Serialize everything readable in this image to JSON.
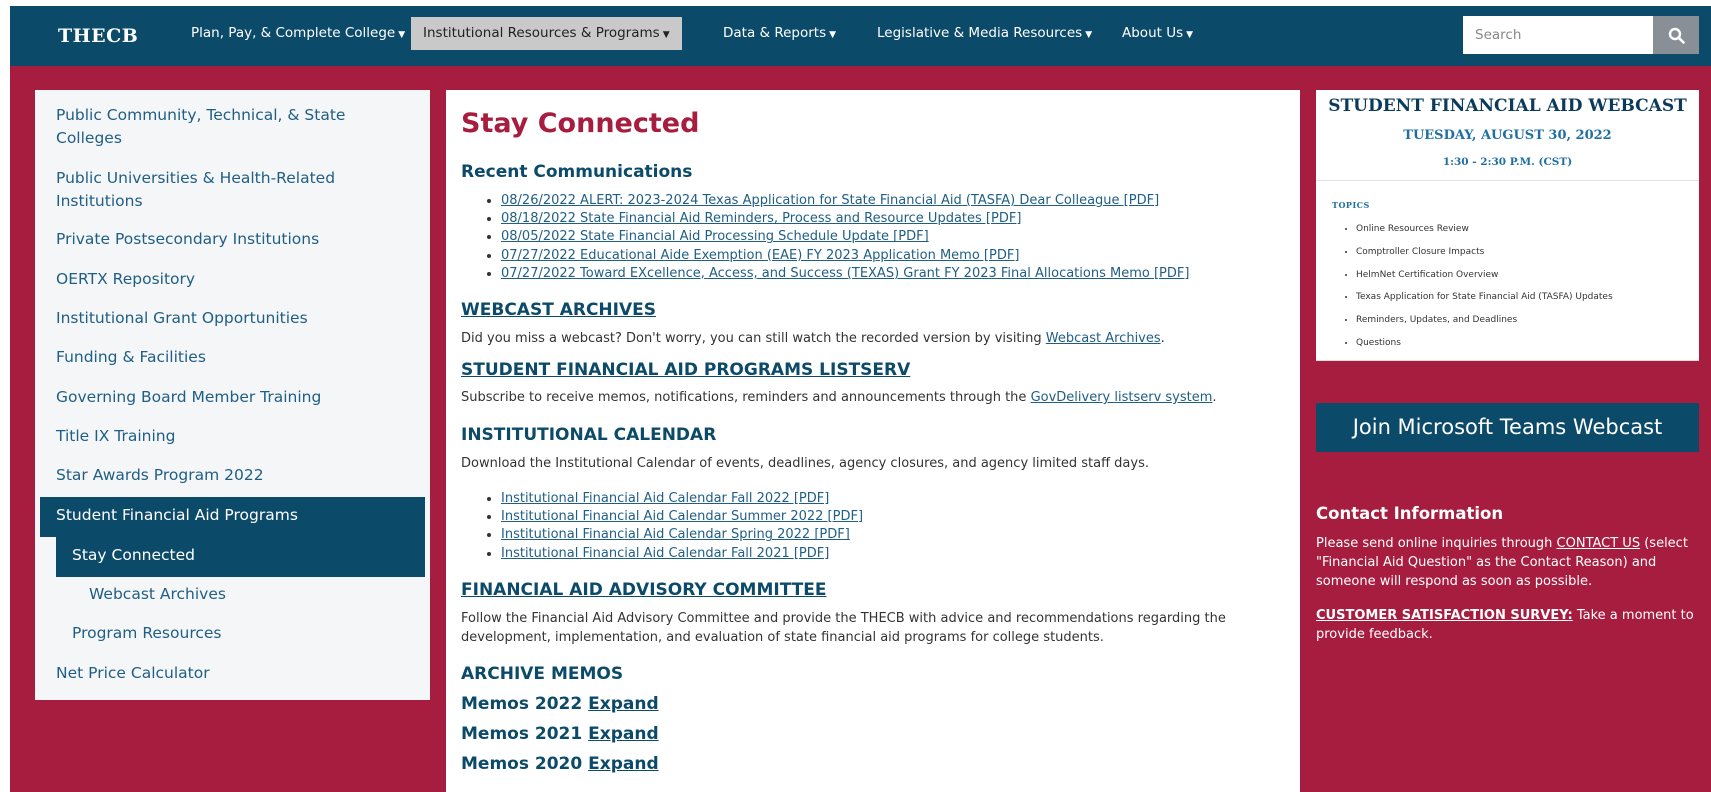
{
  "nav": {
    "logo": "THECB",
    "items": [
      {
        "label": "Plan, Pay, & Complete College"
      },
      {
        "label": "Institutional Resources & Programs"
      },
      {
        "label": "Data & Reports"
      },
      {
        "label": "Legislative & Media Resources"
      },
      {
        "label": "About Us"
      }
    ],
    "search_placeholder": "Search"
  },
  "sidebar": {
    "items": [
      {
        "label": "Public Community, Technical, & State Colleges"
      },
      {
        "label": "Public Universities & Health-Related Institutions"
      },
      {
        "label": "Private Postsecondary Institutions"
      },
      {
        "label": "OERTX Repository"
      },
      {
        "label": "Institutional Grant Opportunities"
      },
      {
        "label": "Funding & Facilities"
      },
      {
        "label": "Governing Board Member Training"
      },
      {
        "label": "Title IX Training"
      },
      {
        "label": "Star Awards Program 2022"
      },
      {
        "label": "Student Financial Aid Programs"
      },
      {
        "label": "Stay Connected"
      },
      {
        "label": "Webcast Archives"
      },
      {
        "label": "Program Resources"
      },
      {
        "label": "Net Price Calculator"
      }
    ]
  },
  "main": {
    "title": "Stay Connected",
    "recent_heading": "Recent Communications",
    "recent_links": [
      "08/26/2022 ALERT: 2023-2024 Texas Application for State Financial Aid (TASFA) Dear Colleague [PDF]",
      "08/18/2022 State Financial Aid Reminders, Process and Resource Updates [PDF]",
      "08/05/2022 State Financial Aid Processing Schedule Update [PDF]",
      "07/27/2022 Educational Aide Exemption (EAE) FY 2023 Application Memo [PDF]",
      "07/27/2022 Toward EXcellence, Access, and Success (TEXAS) Grant FY 2023 Final Allocations Memo [PDF]"
    ],
    "webcast_heading": "WEBCAST ARCHIVES",
    "webcast_text": "Did you miss a webcast? Don't worry, you can still watch the recorded version by visiting ",
    "webcast_link": "Webcast Archives",
    "listserv_heading": "STUDENT FINANCIAL AID PROGRAMS LISTSERV",
    "listserv_text": "Subscribe to receive memos, notifications, reminders and announcements through the ",
    "listserv_link": "GovDelivery listserv system",
    "calendar_heading": "INSTITUTIONAL CALENDAR",
    "calendar_text": "Download the Institutional Calendar of events, deadlines, agency closures, and agency limited staff days.",
    "calendar_links": [
      "Institutional Financial Aid Calendar Fall 2022 [PDF]",
      "Institutional Financial Aid Calendar Summer 2022 [PDF]",
      "Institutional Financial Aid Calendar Spring 2022 [PDF]",
      "Institutional Financial Aid Calendar Fall 2021 [PDF]"
    ],
    "advisory_heading": "FINANCIAL AID ADVISORY COMMITTEE",
    "advisory_text": "Follow the Financial Aid Advisory Committee and provide the THECB with advice and recommendations regarding the development, implementation, and evaluation of state financial aid programs for college students.",
    "archive_heading": "ARCHIVE MEMOS",
    "memos": [
      {
        "label": "Memos 2022",
        "expand": "Expand"
      },
      {
        "label": "Memos 2021",
        "expand": "Expand"
      },
      {
        "label": "Memos 2020",
        "expand": "Expand"
      }
    ]
  },
  "flyer": {
    "title": "STUDENT FINANCIAL AID WEBCAST",
    "date": "TUESDAY, AUGUST 30, 2022",
    "time": "1:30 - 2:30 P.M. (CST)",
    "topics_label": "TOPICS",
    "topics": [
      "Online Resources Review",
      "Comptroller Closure Impacts",
      "HelmNet Certification Overview",
      "Texas Application for State Financial Aid (TASFA) Updates",
      "Reminders, Updates, and Deadlines",
      "Questions"
    ]
  },
  "teams_button": "Join Microsoft Teams Webcast",
  "contact": {
    "heading": "Contact Information",
    "text_before": "Please send online inquiries through ",
    "link": "CONTACT US",
    "text_after": " (select \"Financial Aid Question\" as the Contact Reason) and someone will respond as soon as possible.",
    "survey_link": "CUSTOMER SATISFACTION SURVEY:",
    "survey_text": " Take a moment to provide feedback."
  },
  "colors": {
    "nav_bg": "#0c4a6a",
    "page_bg": "#a71d3f",
    "title_red": "#a71d3f",
    "link_blue": "#1f5e85"
  }
}
